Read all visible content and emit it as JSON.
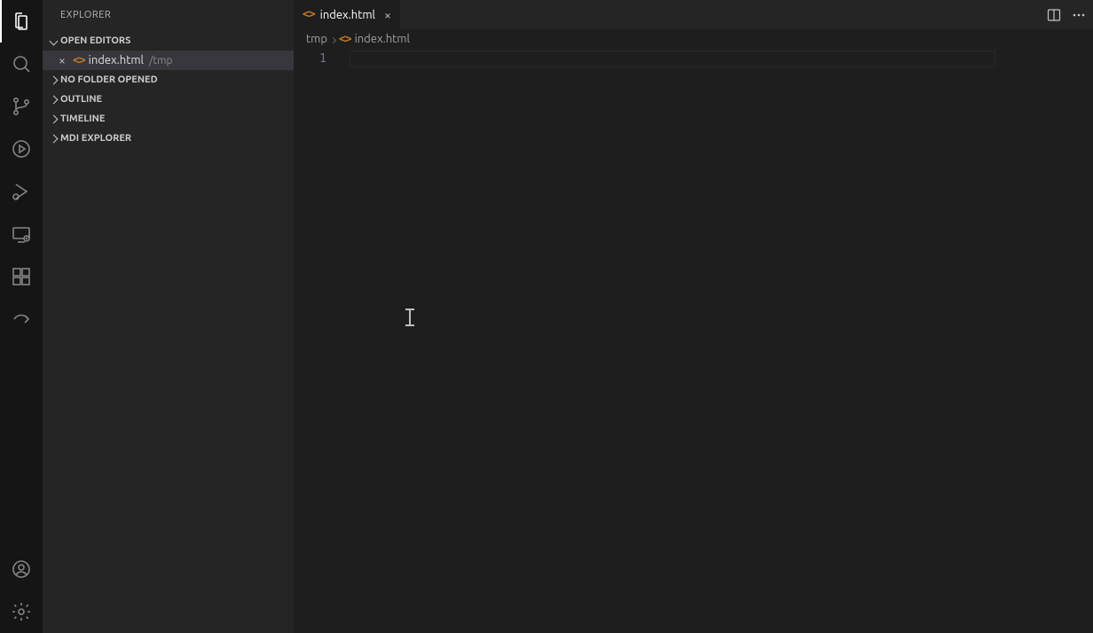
{
  "activity": {
    "items": [
      {
        "name": "explorer",
        "active": true
      },
      {
        "name": "search",
        "active": false
      },
      {
        "name": "scm",
        "active": false
      },
      {
        "name": "run-debug",
        "active": false
      },
      {
        "name": "debug-alt",
        "active": false
      },
      {
        "name": "remote",
        "active": false
      },
      {
        "name": "extensions",
        "active": false
      },
      {
        "name": "live-share",
        "active": false
      }
    ],
    "bottom": [
      {
        "name": "accounts"
      },
      {
        "name": "settings"
      }
    ]
  },
  "sidebar": {
    "title": "EXPLORER",
    "sections": [
      {
        "label": "OPEN EDITORS",
        "expanded": true
      },
      {
        "label": "NO FOLDER OPENED",
        "expanded": false
      },
      {
        "label": "OUTLINE",
        "expanded": false
      },
      {
        "label": "TIMELINE",
        "expanded": false
      },
      {
        "label": "MDI EXPLORER",
        "expanded": false
      }
    ],
    "openEditors": [
      {
        "name": "index.html",
        "path": "/tmp"
      }
    ]
  },
  "tab": {
    "label": "index.html"
  },
  "breadcrumbs": {
    "folder": "tmp",
    "file": "index.html"
  },
  "editor": {
    "lineNumber": "1"
  }
}
